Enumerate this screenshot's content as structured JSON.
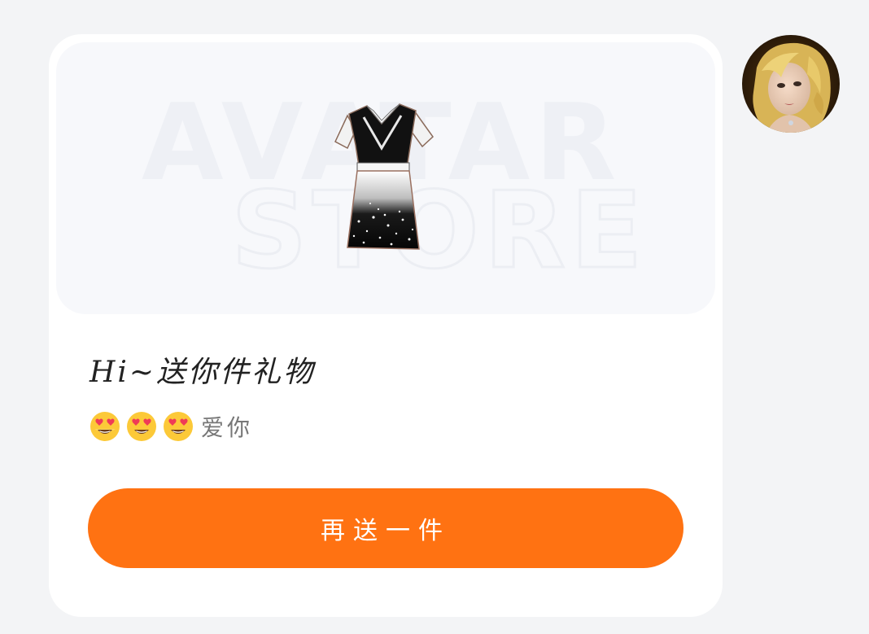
{
  "product": {
    "watermark_line1": "AVATAR",
    "watermark_line2": "STORE",
    "item_icon": "dress-icon"
  },
  "card": {
    "title": "Hi~送你件礼物",
    "emoji_icon": "heart-eyes-emoji",
    "emoji_count": 3,
    "message": "爱你",
    "button_label": "再送一件"
  },
  "avatar": {
    "icon": "user-avatar"
  },
  "colors": {
    "accent": "#ff7212",
    "background": "#f3f4f6",
    "card": "#ffffff"
  }
}
